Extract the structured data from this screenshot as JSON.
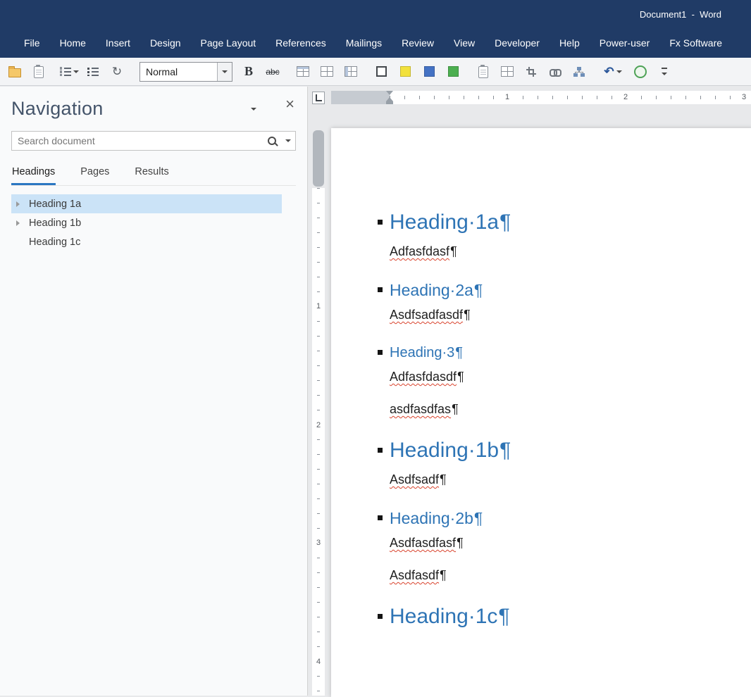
{
  "title_bar": {
    "title": "Document1  -  Word"
  },
  "menu": {
    "tabs": [
      "File",
      "Home",
      "Insert",
      "Design",
      "Page Layout",
      "References",
      "Mailings",
      "Review",
      "View",
      "Developer",
      "Help",
      "Power-user",
      "Fx Software"
    ]
  },
  "toolbar": {
    "style_selector": "Normal",
    "bold": "B",
    "strikethrough": "abc",
    "sync": "↻",
    "undo": "↶",
    "swatches": [
      {
        "name": "white",
        "style": "background:#ffffff;box-shadow:inset 0 0 0 2px #43474c"
      },
      {
        "name": "yellow",
        "style": "background:#f2e13c"
      },
      {
        "name": "blue",
        "style": "background:#4472c4"
      },
      {
        "name": "green",
        "style": "background:#4caf50"
      }
    ]
  },
  "navigation": {
    "title": "Navigation",
    "close": "×",
    "search_placeholder": "Search document",
    "tabs": [
      "Headings",
      "Pages",
      "Results"
    ],
    "items": [
      {
        "label": "Heading 1a"
      },
      {
        "label": "Heading 1b"
      },
      {
        "label": "Heading 1c"
      }
    ]
  },
  "rulers": {
    "horizontal": [
      "1",
      "2",
      "3"
    ],
    "vertical": [
      "1",
      "2",
      "3",
      "4"
    ]
  },
  "document": {
    "blocks": [
      {
        "type": "h1",
        "text": "Heading·1a",
        "pilcrow": "¶"
      },
      {
        "type": "body",
        "text": "Adfasfdasf",
        "pilcrow": "¶"
      },
      {
        "type": "h2",
        "text": "Heading·2a",
        "pilcrow": "¶"
      },
      {
        "type": "body",
        "text": "Asdfsadfasdf",
        "pilcrow": "¶"
      },
      {
        "type": "h3",
        "text": "Heading·3",
        "pilcrow": "¶"
      },
      {
        "type": "body",
        "text": "Adfasfdasdf",
        "pilcrow": "¶"
      },
      {
        "type": "body",
        "text": "asdfasdfas",
        "pilcrow": "¶"
      },
      {
        "type": "h1",
        "text": "Heading·1b",
        "pilcrow": "¶"
      },
      {
        "type": "body",
        "text": "Asdfsadf",
        "pilcrow": "¶"
      },
      {
        "type": "h2",
        "text": "Heading·2b",
        "pilcrow": "¶"
      },
      {
        "type": "body",
        "text": "Asdfasdfasf",
        "pilcrow": "¶"
      },
      {
        "type": "body",
        "text": "Asdfasdf",
        "pilcrow": "¶"
      },
      {
        "type": "h1",
        "text": "Heading·1c",
        "pilcrow": "¶"
      }
    ]
  }
}
